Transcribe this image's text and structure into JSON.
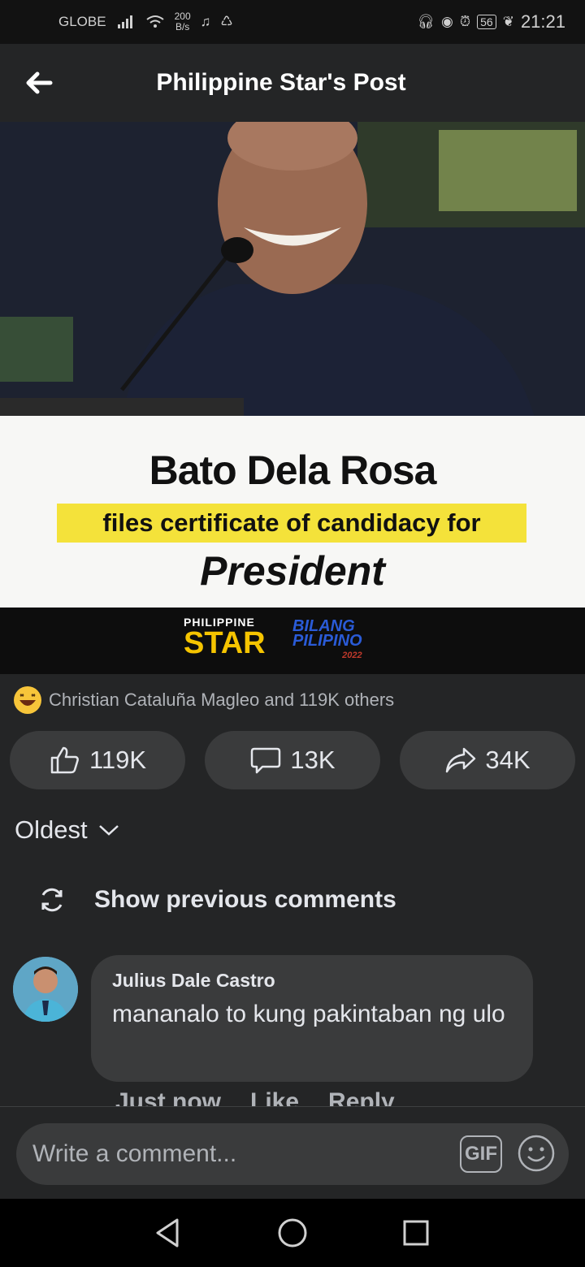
{
  "status_bar": {
    "carrier": "GLOBE",
    "net_speed_value": "200",
    "net_speed_unit": "B/s",
    "battery": "56",
    "time": "21:21"
  },
  "header": {
    "title": "Philippine Star's Post"
  },
  "post_image": {
    "headline": "Bato Dela Rosa",
    "subline": "files certificate of candidacy for",
    "bottom": "President",
    "brand_small": "PHILIPPINE",
    "brand_big": "STAR",
    "brand2_line1": "BILANG",
    "brand2_line2": "PILIPINO",
    "brand2_year": "2022"
  },
  "reactions": {
    "summary": "Christian Cataluña Magleo and 119K others"
  },
  "actions": {
    "like_count": "119K",
    "comment_count": "13K",
    "share_count": "34K"
  },
  "comments_section": {
    "sort_label": "Oldest",
    "show_previous": "Show previous comments"
  },
  "comment": {
    "author": "Julius Dale Castro",
    "text": "mananalo to kung pakintaban ng ulo",
    "meta": [
      "Just now",
      "Like",
      "Reply"
    ]
  },
  "composer": {
    "placeholder": "Write a comment...",
    "gif_label": "GIF"
  },
  "colors": {
    "background": "#242526",
    "bubble": "#3a3b3c",
    "text_primary": "#e4e6eb",
    "text_secondary": "#b0b3b8",
    "banner_highlight": "#f4e23a"
  }
}
